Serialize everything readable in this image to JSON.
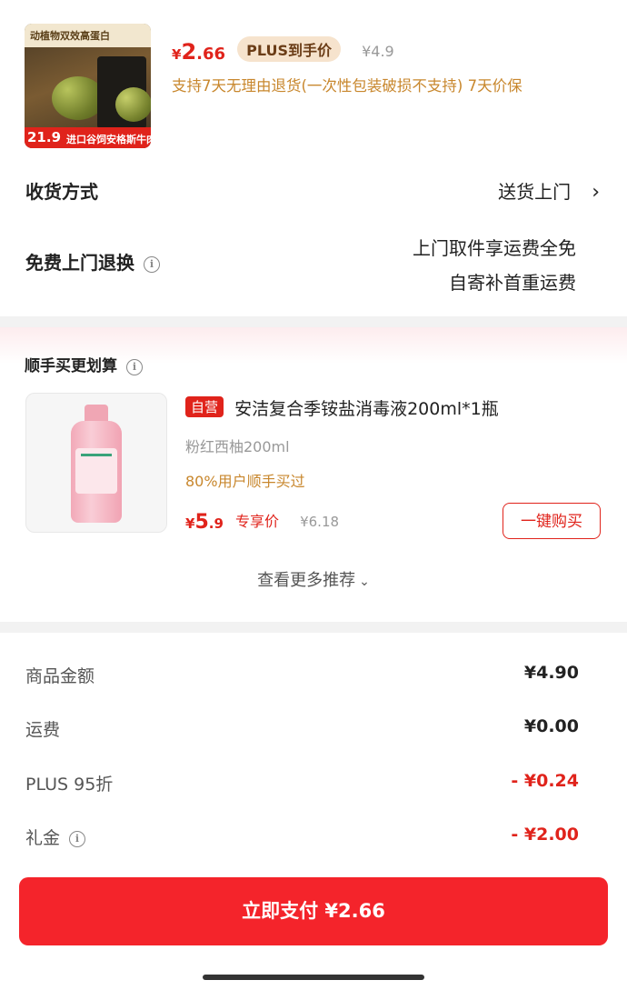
{
  "product": {
    "thumb_band_text": "动植物双效高蛋白",
    "thumb_price": "21.9",
    "thumb_tag": "进口谷饲安格斯牛肉",
    "price_symbol": "¥",
    "price_int": "2",
    "price_dec": ".66",
    "plus_label": "PLUS到手价",
    "original_price": "¥4.9",
    "support_text": "支持7天无理由退货(一次性包装破损不支持) 7天价保"
  },
  "delivery": {
    "label": "收货方式",
    "value": "送货上门",
    "chevron": "›"
  },
  "returns": {
    "label": "免费上门退换",
    "info_icon": "i",
    "line1": "上门取件享运费全免",
    "line2": "自寄补首重运费"
  },
  "recommend": {
    "title": "顺手买更划算",
    "info_icon": "i",
    "badge": "自营",
    "name": "安洁复合季铵盐消毒液200ml*1瓶",
    "spec": "粉红西柚200ml",
    "bought": "80%用户顺手买过",
    "price_symbol": "¥",
    "price_int": "5",
    "price_dec": ".9",
    "exclusive_label": "专享价",
    "original_price": "¥6.18",
    "buy_label": "一键购买",
    "more_label": "查看更多推荐",
    "more_chevron": "⌄"
  },
  "summary": {
    "rows": [
      {
        "label": "商品金额",
        "value": "¥4.90"
      },
      {
        "label": "运费",
        "value": "¥0.00"
      },
      {
        "label": "PLUS 95折",
        "value": "- ¥0.24"
      },
      {
        "label": "礼金",
        "value": "- ¥2.00"
      }
    ]
  },
  "pay_button": {
    "label": "立即支付 ¥2.66"
  },
  "colors": {
    "accent": "#e0231b",
    "gold_text": "#c8872d",
    "pay_button": "#f4242b"
  }
}
